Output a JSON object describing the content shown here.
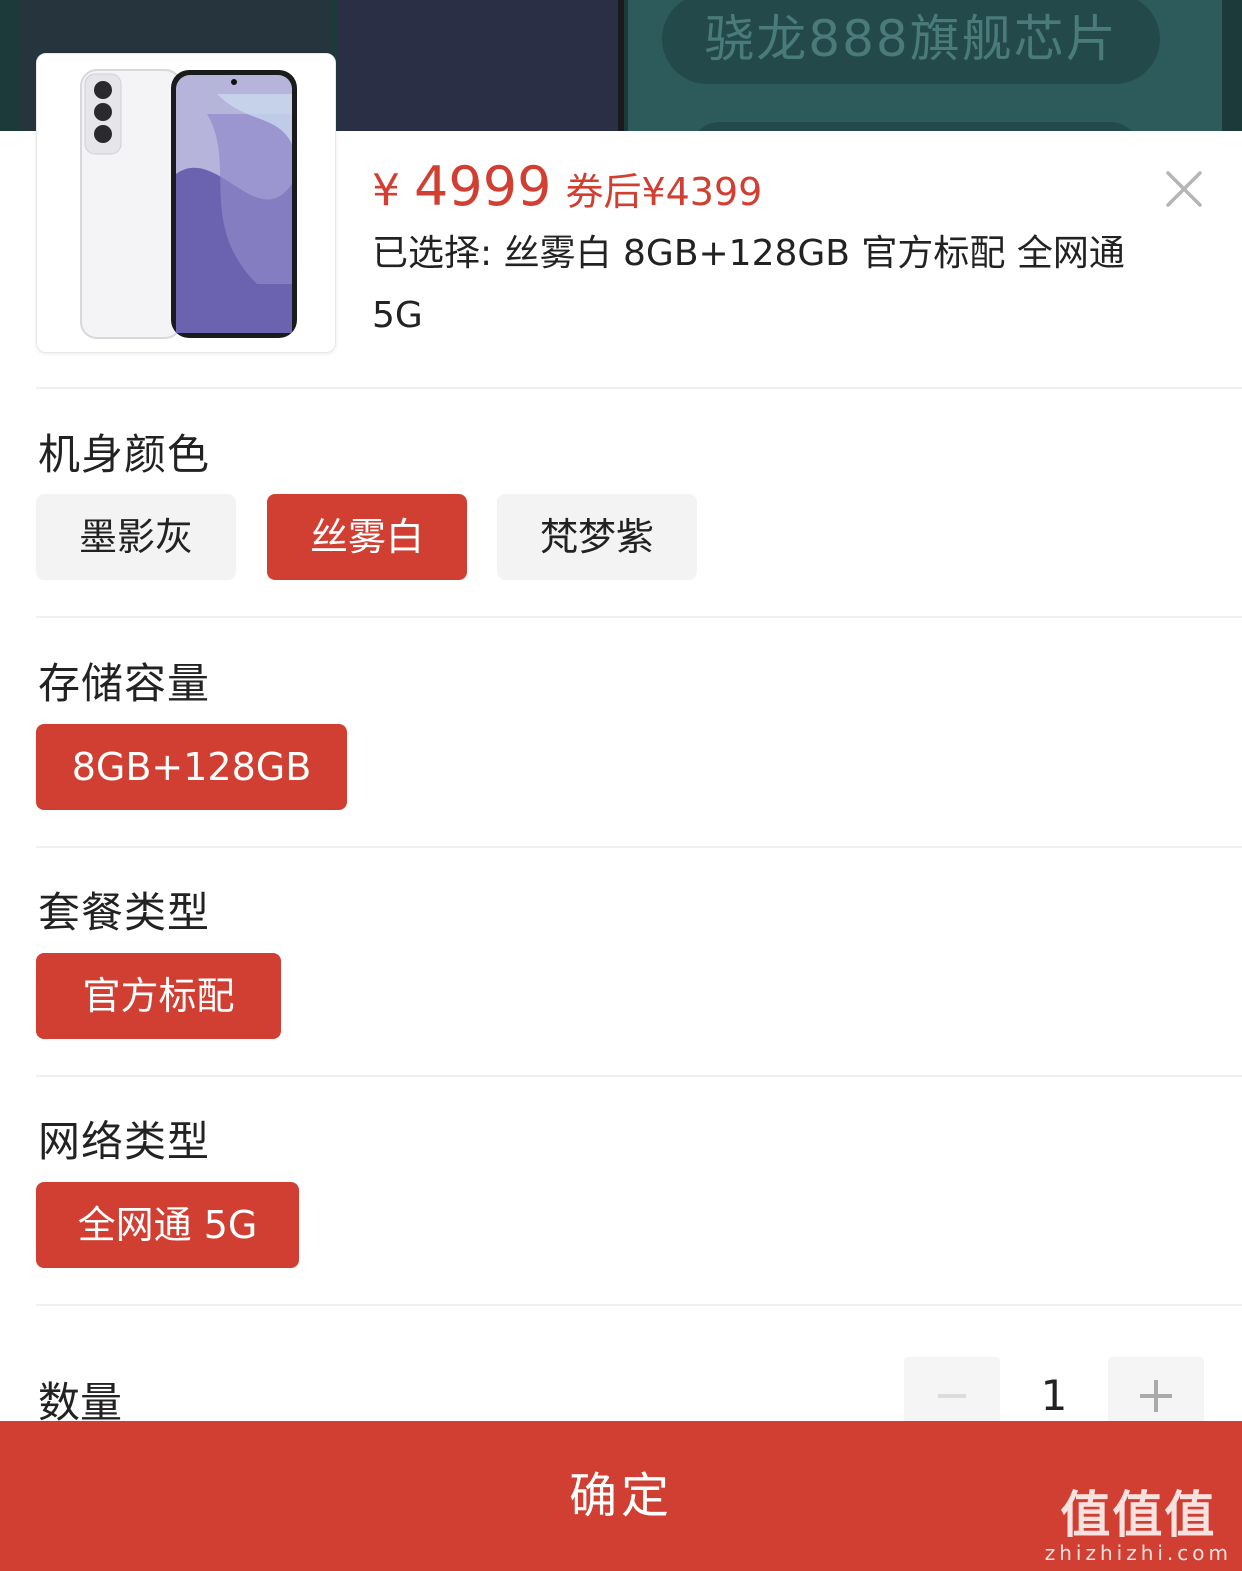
{
  "background": {
    "banner_text": "骁龙888旗舰芯片"
  },
  "product": {
    "image_icon": "phone-product-image",
    "price_symbol": "¥",
    "price": "4999",
    "coupon_price": "券后¥4399",
    "selected_summary": "已选择: 丝雾白 8GB+128GB 官方标配 全网通 5G"
  },
  "close_icon": "close-x",
  "sections": {
    "color": {
      "title": "机身颜色",
      "options": [
        {
          "label": "墨影灰",
          "selected": false
        },
        {
          "label": "丝雾白",
          "selected": true
        },
        {
          "label": "梵梦紫",
          "selected": false
        }
      ]
    },
    "storage": {
      "title": "存储容量",
      "options": [
        {
          "label": "8GB+128GB",
          "selected": true
        }
      ]
    },
    "package": {
      "title": "套餐类型",
      "options": [
        {
          "label": "官方标配",
          "selected": true
        }
      ]
    },
    "network": {
      "title": "网络类型",
      "options": [
        {
          "label": "全网通 5G",
          "selected": true
        }
      ]
    }
  },
  "quantity": {
    "label": "数量",
    "value": "1",
    "minus_icon": "minus",
    "plus_icon": "plus"
  },
  "confirm_label": "确定",
  "watermark": {
    "big": "值值值",
    "small": "zhizhizhi.com"
  },
  "colors": {
    "accent": "#d13f32",
    "chip_bg": "#f3f3f3",
    "text": "#222222"
  }
}
